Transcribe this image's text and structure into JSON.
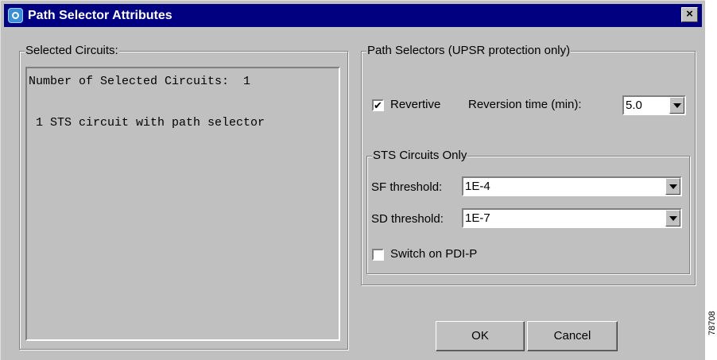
{
  "window": {
    "title": "Path Selector Attributes",
    "close_label": "×"
  },
  "selected_circuits": {
    "legend": "Selected Circuits:",
    "lines": [
      "Number of Selected Circuits:  1",
      " 1 STS circuit with path selector"
    ]
  },
  "path_selectors": {
    "legend": "Path Selectors (UPSR protection only)",
    "revertive": {
      "label": "Revertive",
      "checked": true,
      "mark": "✔"
    },
    "reversion_time": {
      "label": "Reversion time (min):",
      "value": "5.0"
    },
    "sts_group": {
      "legend": "STS Circuits Only",
      "sf_threshold": {
        "label": "SF threshold:",
        "value": "1E-4"
      },
      "sd_threshold": {
        "label": "SD threshold:",
        "value": "1E-7"
      },
      "switch_pdi": {
        "label": "Switch on PDI-P",
        "checked": false,
        "mark": ""
      }
    }
  },
  "buttons": {
    "ok": "OK",
    "cancel": "Cancel"
  },
  "side_mark": "78708"
}
